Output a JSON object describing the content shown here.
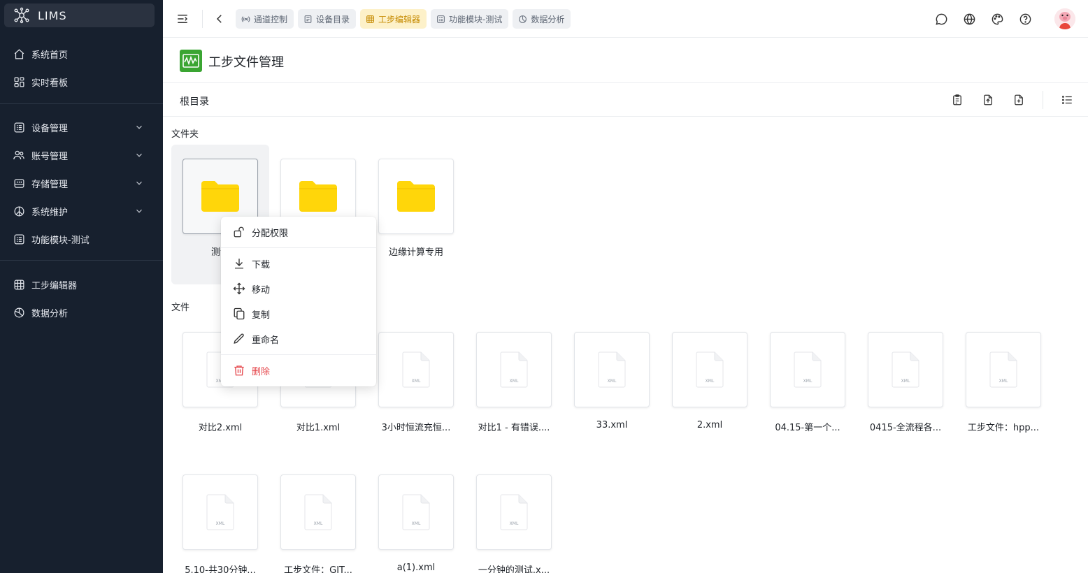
{
  "brand": {
    "name": "LIMS"
  },
  "sidebar": {
    "items": [
      {
        "label": "系统首页",
        "icon": "home-icon"
      },
      {
        "label": "实时看板",
        "icon": "dashboard-icon"
      },
      {
        "label": "设备管理",
        "icon": "device-icon",
        "expandable": true
      },
      {
        "label": "账号管理",
        "icon": "users-icon",
        "expandable": true
      },
      {
        "label": "存储管理",
        "icon": "storage-icon",
        "expandable": true
      },
      {
        "label": "系统维护",
        "icon": "maintenance-icon",
        "expandable": true
      },
      {
        "label": "功能模块-测试",
        "icon": "module-icon"
      },
      {
        "label": "工步编辑器",
        "icon": "grid-icon"
      },
      {
        "label": "数据分析",
        "icon": "pie-chart-icon"
      }
    ]
  },
  "tabs": [
    {
      "label": "通道控制",
      "icon": "signal-icon",
      "active": false
    },
    {
      "label": "设备目录",
      "icon": "list-icon",
      "active": false
    },
    {
      "label": "工步编辑器",
      "icon": "grid-icon",
      "active": true
    },
    {
      "label": "功能模块-测试",
      "icon": "module-icon",
      "active": false
    },
    {
      "label": "数据分析",
      "icon": "pie-chart-icon",
      "active": false
    }
  ],
  "page": {
    "title": "工步文件管理",
    "breadcrumb": "根目录",
    "folders_label": "文件夹",
    "files_label": "文件"
  },
  "folders": [
    {
      "name": "测试"
    },
    {
      "name": ""
    },
    {
      "name": "边缘计算专用"
    }
  ],
  "files": [
    {
      "name": "对比2.xml"
    },
    {
      "name": "对比1.xml"
    },
    {
      "name": "3小时恒流充恒..."
    },
    {
      "name": "对比1 - 有错误...."
    },
    {
      "name": "33.xml"
    },
    {
      "name": "2.xml"
    },
    {
      "name": "04.15-第一个..."
    },
    {
      "name": "0415-全流程各..."
    },
    {
      "name": "工步文件：hpp..."
    },
    {
      "name": "5.10-共30分钟..."
    },
    {
      "name": "工步文件：GIT..."
    },
    {
      "name": "a(1).xml"
    },
    {
      "name": "一分钟的测试.x..."
    }
  ],
  "file_type_label": "XML",
  "context_menu": {
    "items": [
      {
        "label": "分配权限",
        "icon": "permission-icon"
      },
      {
        "label": "下载",
        "icon": "download-icon"
      },
      {
        "label": "移动",
        "icon": "move-icon"
      },
      {
        "label": "复制",
        "icon": "copy-icon"
      },
      {
        "label": "重命名",
        "icon": "rename-icon"
      },
      {
        "label": "删除",
        "icon": "trash-icon"
      }
    ]
  },
  "colors": {
    "sidebar_bg": "#17202e",
    "active_tab_bg": "#fdf1c9",
    "active_tab_text": "#c58a00",
    "folder": "#ffd60a",
    "danger": "#e5484d",
    "page_logo": "#3aa532"
  }
}
